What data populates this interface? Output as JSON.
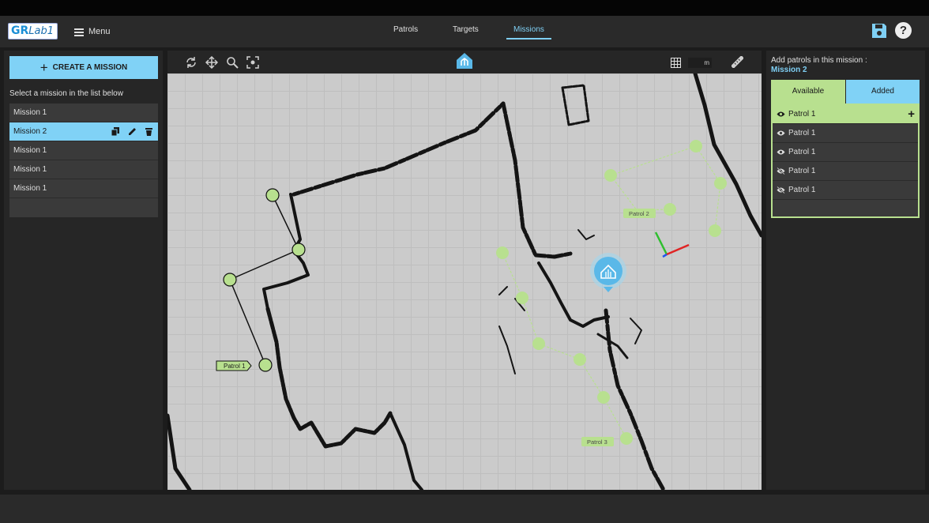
{
  "header": {
    "logo_part1": "GR",
    "logo_part2": "Lab1",
    "menu_label": "Menu",
    "nav": [
      {
        "label": "Patrols",
        "active": false
      },
      {
        "label": "Targets",
        "active": false
      },
      {
        "label": "Missions",
        "active": true
      }
    ],
    "icons": [
      "save-icon",
      "help-icon"
    ],
    "help_glyph": "?"
  },
  "left_panel": {
    "create_label": "CREATE A MISSION",
    "list_caption": "Select a mission in the list below",
    "missions": [
      {
        "label": "Mission 1",
        "selected": false
      },
      {
        "label": "Mission 2",
        "selected": true
      },
      {
        "label": "Mission 1",
        "selected": false
      },
      {
        "label": "Mission 1",
        "selected": false
      },
      {
        "label": "Mission 1",
        "selected": false
      }
    ],
    "item_actions": [
      "copy-icon",
      "edit-icon",
      "delete-icon"
    ]
  },
  "map_toolbar": {
    "tools": [
      "rotate-icon",
      "pan-icon",
      "zoom-icon",
      "fit-view-icon",
      "home-icon",
      "grid-icon",
      "ruler-icon"
    ],
    "grid_unit": "m"
  },
  "map": {
    "patrol_labels": [
      "Patrol 1",
      "Patrol 2",
      "Patrol 3"
    ],
    "colors": {
      "waypoint": "#b8e08f",
      "route_black": "#111111",
      "route_green": "#b8e08f",
      "robot": "#5ab8e8"
    }
  },
  "right_panel": {
    "caption": "Add patrols in this mission :",
    "mission_name": "Mission 2",
    "tabs": {
      "available": "Available",
      "added": "Added"
    },
    "patrols": [
      {
        "label": "Patrol 1",
        "visible": true,
        "active": true
      },
      {
        "label": "Patrol 1",
        "visible": true,
        "active": false
      },
      {
        "label": "Patrol 1",
        "visible": true,
        "active": false
      },
      {
        "label": "Patrol 1",
        "visible": false,
        "active": false
      },
      {
        "label": "Patrol 1",
        "visible": false,
        "active": false
      }
    ],
    "add_glyph": "+"
  },
  "colors": {
    "accent_blue": "#80d2f6",
    "accent_green": "#b8e08f",
    "background": "#1c1c1c"
  }
}
